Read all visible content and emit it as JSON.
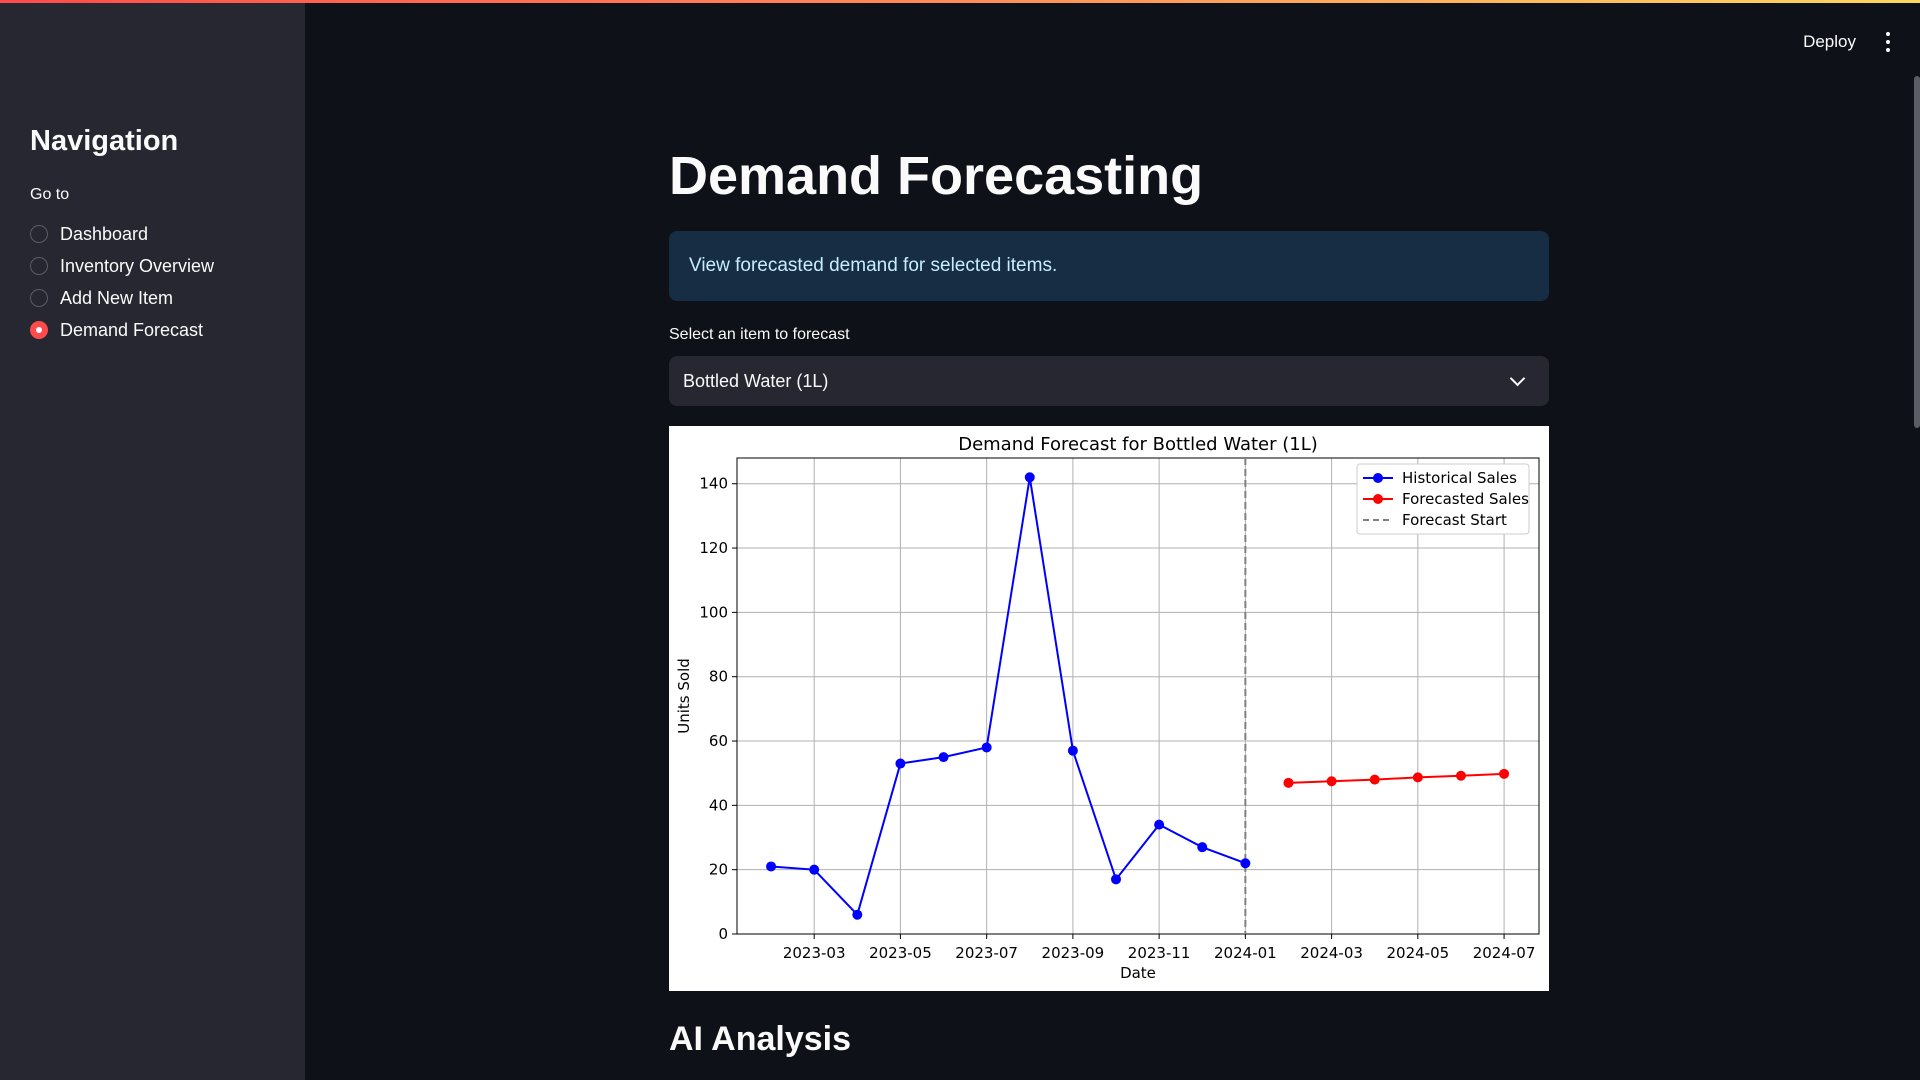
{
  "sidebar": {
    "title": "Navigation",
    "goto_label": "Go to",
    "items": [
      {
        "label": "Dashboard",
        "selected": false
      },
      {
        "label": "Inventory Overview",
        "selected": false
      },
      {
        "label": "Add New Item",
        "selected": false
      },
      {
        "label": "Demand Forecast",
        "selected": true
      }
    ]
  },
  "header": {
    "deploy_label": "Deploy",
    "menu_icon": "kebab-menu-icon"
  },
  "main": {
    "title": "Demand Forecasting",
    "info": "View forecasted demand for selected items.",
    "select_label": "Select an item to forecast",
    "select_value": "Bottled Water (1L)",
    "section_title": "AI Analysis"
  },
  "colors": {
    "accent": "#ff4b4b",
    "historical": "#0000ff",
    "forecast": "#ff0000",
    "forecast_start": "#808080",
    "info_bg": "#172d43",
    "info_text": "#c7ebff"
  },
  "chart_data": {
    "type": "line",
    "title": "Demand Forecast for Bottled Water (1L)",
    "xlabel": "Date",
    "ylabel": "Units Sold",
    "ylim": [
      0,
      148
    ],
    "y_ticks": [
      0,
      20,
      40,
      60,
      80,
      100,
      120,
      140
    ],
    "x_ticks": [
      "2023-03",
      "2023-05",
      "2023-07",
      "2023-09",
      "2023-11",
      "2024-01",
      "2024-03",
      "2024-05",
      "2024-07"
    ],
    "grid": true,
    "legend_position": "top-right",
    "forecast_start": "2024-01",
    "series": [
      {
        "name": "Historical Sales",
        "color": "#0000ff",
        "style": "solid-marker",
        "x": [
          "2023-02",
          "2023-03",
          "2023-04",
          "2023-05",
          "2023-06",
          "2023-07",
          "2023-08",
          "2023-09",
          "2023-10",
          "2023-11",
          "2023-12",
          "2024-01"
        ],
        "values": [
          21,
          20,
          6,
          53,
          55,
          58,
          142,
          57,
          17,
          34,
          27,
          22
        ]
      },
      {
        "name": "Forecasted Sales",
        "color": "#ff0000",
        "style": "solid-marker",
        "x": [
          "2024-02",
          "2024-03",
          "2024-04",
          "2024-05",
          "2024-06",
          "2024-07"
        ],
        "values": [
          47,
          47.5,
          48,
          48.7,
          49.2,
          49.8
        ]
      },
      {
        "name": "Forecast Start",
        "color": "#808080",
        "style": "dashed"
      }
    ]
  }
}
